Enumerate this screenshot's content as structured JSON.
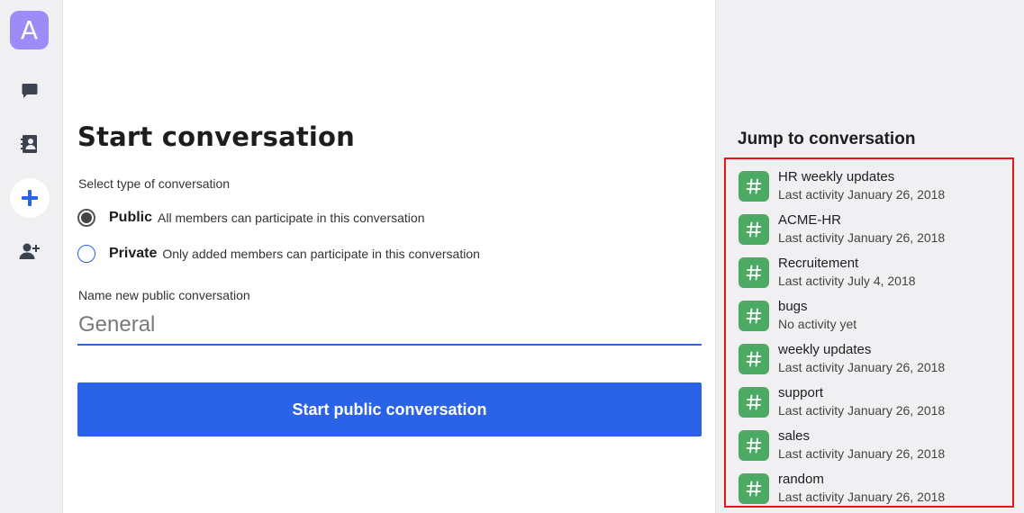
{
  "rail": {
    "avatar_letter": "A",
    "icons": [
      "chat-bubble-icon",
      "contacts-book-icon",
      "plus-icon",
      "add-user-icon"
    ],
    "accent": "#2a62e8",
    "avatar_color": "#9d8cf7"
  },
  "main": {
    "title": "Start conversation",
    "type_label": "Select type of conversation",
    "options": [
      {
        "title": "Public",
        "description": "All members can participate in this conversation",
        "selected": true
      },
      {
        "title": "Private",
        "description": "Only added members can participate in this conversation",
        "selected": false
      }
    ],
    "name_label": "Name new public conversation",
    "name_placeholder": "General",
    "name_value": "",
    "submit_label": "Start public conversation"
  },
  "sidebar": {
    "title": "Jump to conversation",
    "highlight_color": "#e8141b",
    "channel_color": "#4caa64",
    "conversations": [
      {
        "name": "HR weekly updates",
        "activity": "Last activity January 26, 2018"
      },
      {
        "name": "ACME-HR",
        "activity": "Last activity January 26, 2018"
      },
      {
        "name": "Recruitement",
        "activity": "Last activity July 4, 2018"
      },
      {
        "name": "bugs",
        "activity": "No activity yet"
      },
      {
        "name": "weekly updates",
        "activity": "Last activity January 26, 2018"
      },
      {
        "name": "support",
        "activity": "Last activity January 26, 2018"
      },
      {
        "name": "sales",
        "activity": "Last activity January 26, 2018"
      },
      {
        "name": "random",
        "activity": "Last activity January 26, 2018"
      }
    ]
  }
}
